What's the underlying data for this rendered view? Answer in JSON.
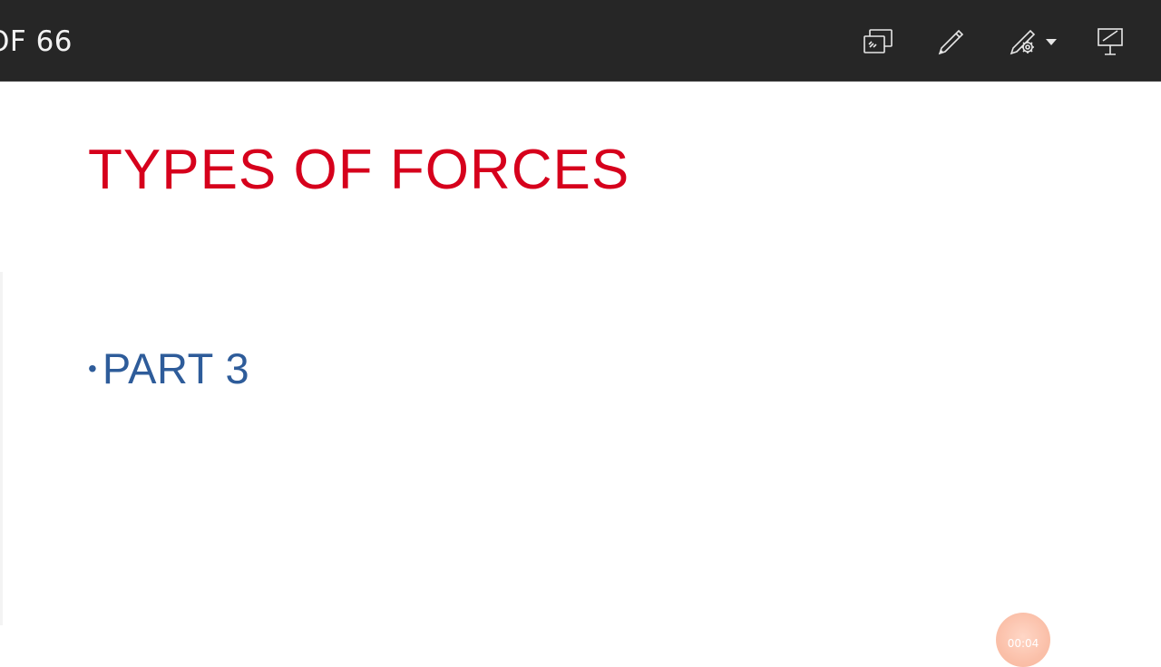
{
  "toolbar": {
    "slide_counter": "OF 66",
    "buttons": [
      {
        "name": "display-settings",
        "icon": "display-settings-icon"
      },
      {
        "name": "pen",
        "icon": "pen-icon"
      },
      {
        "name": "highlighter-options",
        "icon": "highlighter-gear-icon"
      },
      {
        "name": "exit",
        "icon": "easel-exit-icon"
      }
    ]
  },
  "slide": {
    "title": "TYPES OF FORCES",
    "bullets": [
      {
        "text": "PART 3"
      }
    ],
    "colors": {
      "title": "#d6001c",
      "bullet": "#2e5c9a"
    }
  },
  "recorder": {
    "time": "00:04"
  }
}
